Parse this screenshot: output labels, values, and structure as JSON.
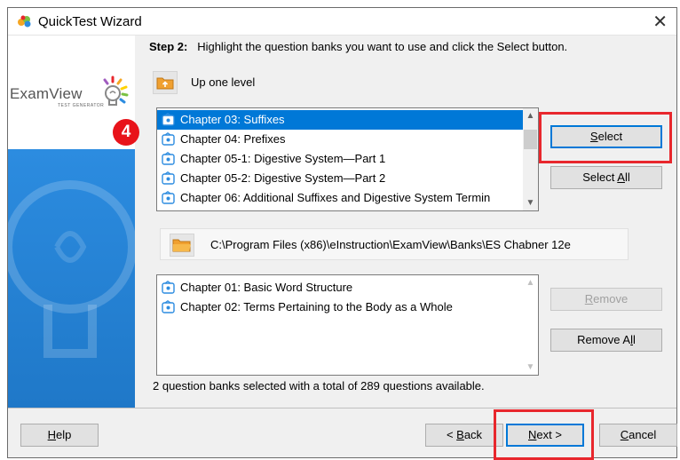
{
  "window": {
    "title": "QuickTest Wizard"
  },
  "sidebar": {
    "logo_text": "ExamView",
    "logo_sub": "TEST GENERATOR",
    "step_badge": "4"
  },
  "step": {
    "label": "Step 2:",
    "instruction": "Highlight the question banks you want to use and click the Select button."
  },
  "up_level": {
    "label": "Up one level"
  },
  "available_banks": [
    {
      "label": "Chapter 03: Suffixes",
      "selected": true
    },
    {
      "label": "Chapter 04: Prefixes",
      "selected": false
    },
    {
      "label": "Chapter 05-1: Digestive System—Part 1",
      "selected": false
    },
    {
      "label": "Chapter 05-2: Digestive System—Part 2",
      "selected": false
    },
    {
      "label": "Chapter 06: Additional Suffixes and Digestive System Termin",
      "selected": false
    }
  ],
  "path": {
    "text": "C:\\Program Files (x86)\\eInstruction\\ExamView\\Banks\\ES Chabner 12e"
  },
  "selected_banks": [
    {
      "label": "Chapter 01: Basic Word Structure"
    },
    {
      "label": "Chapter 02: Terms Pertaining to the Body as a Whole"
    }
  ],
  "buttons": {
    "select": {
      "pre": "",
      "key": "S",
      "post": "elect"
    },
    "select_all": {
      "pre": "Select ",
      "key": "A",
      "post": "ll"
    },
    "remove": {
      "pre": "",
      "key": "R",
      "post": "emove"
    },
    "remove_all": {
      "pre": "Remove A",
      "key": "l",
      "post": "l"
    },
    "help": {
      "pre": "",
      "key": "H",
      "post": "elp"
    },
    "back": {
      "pre": "< ",
      "key": "B",
      "post": "ack"
    },
    "next": {
      "pre": "",
      "key": "N",
      "post": "ext >"
    },
    "cancel": {
      "pre": "",
      "key": "C",
      "post": "ancel"
    }
  },
  "status": {
    "text": "2 question banks selected with a total of 289 questions available."
  },
  "colors": {
    "accent": "#0078d7",
    "highlight": "#e8272d",
    "sidebar_blue": "#1f78c8"
  }
}
